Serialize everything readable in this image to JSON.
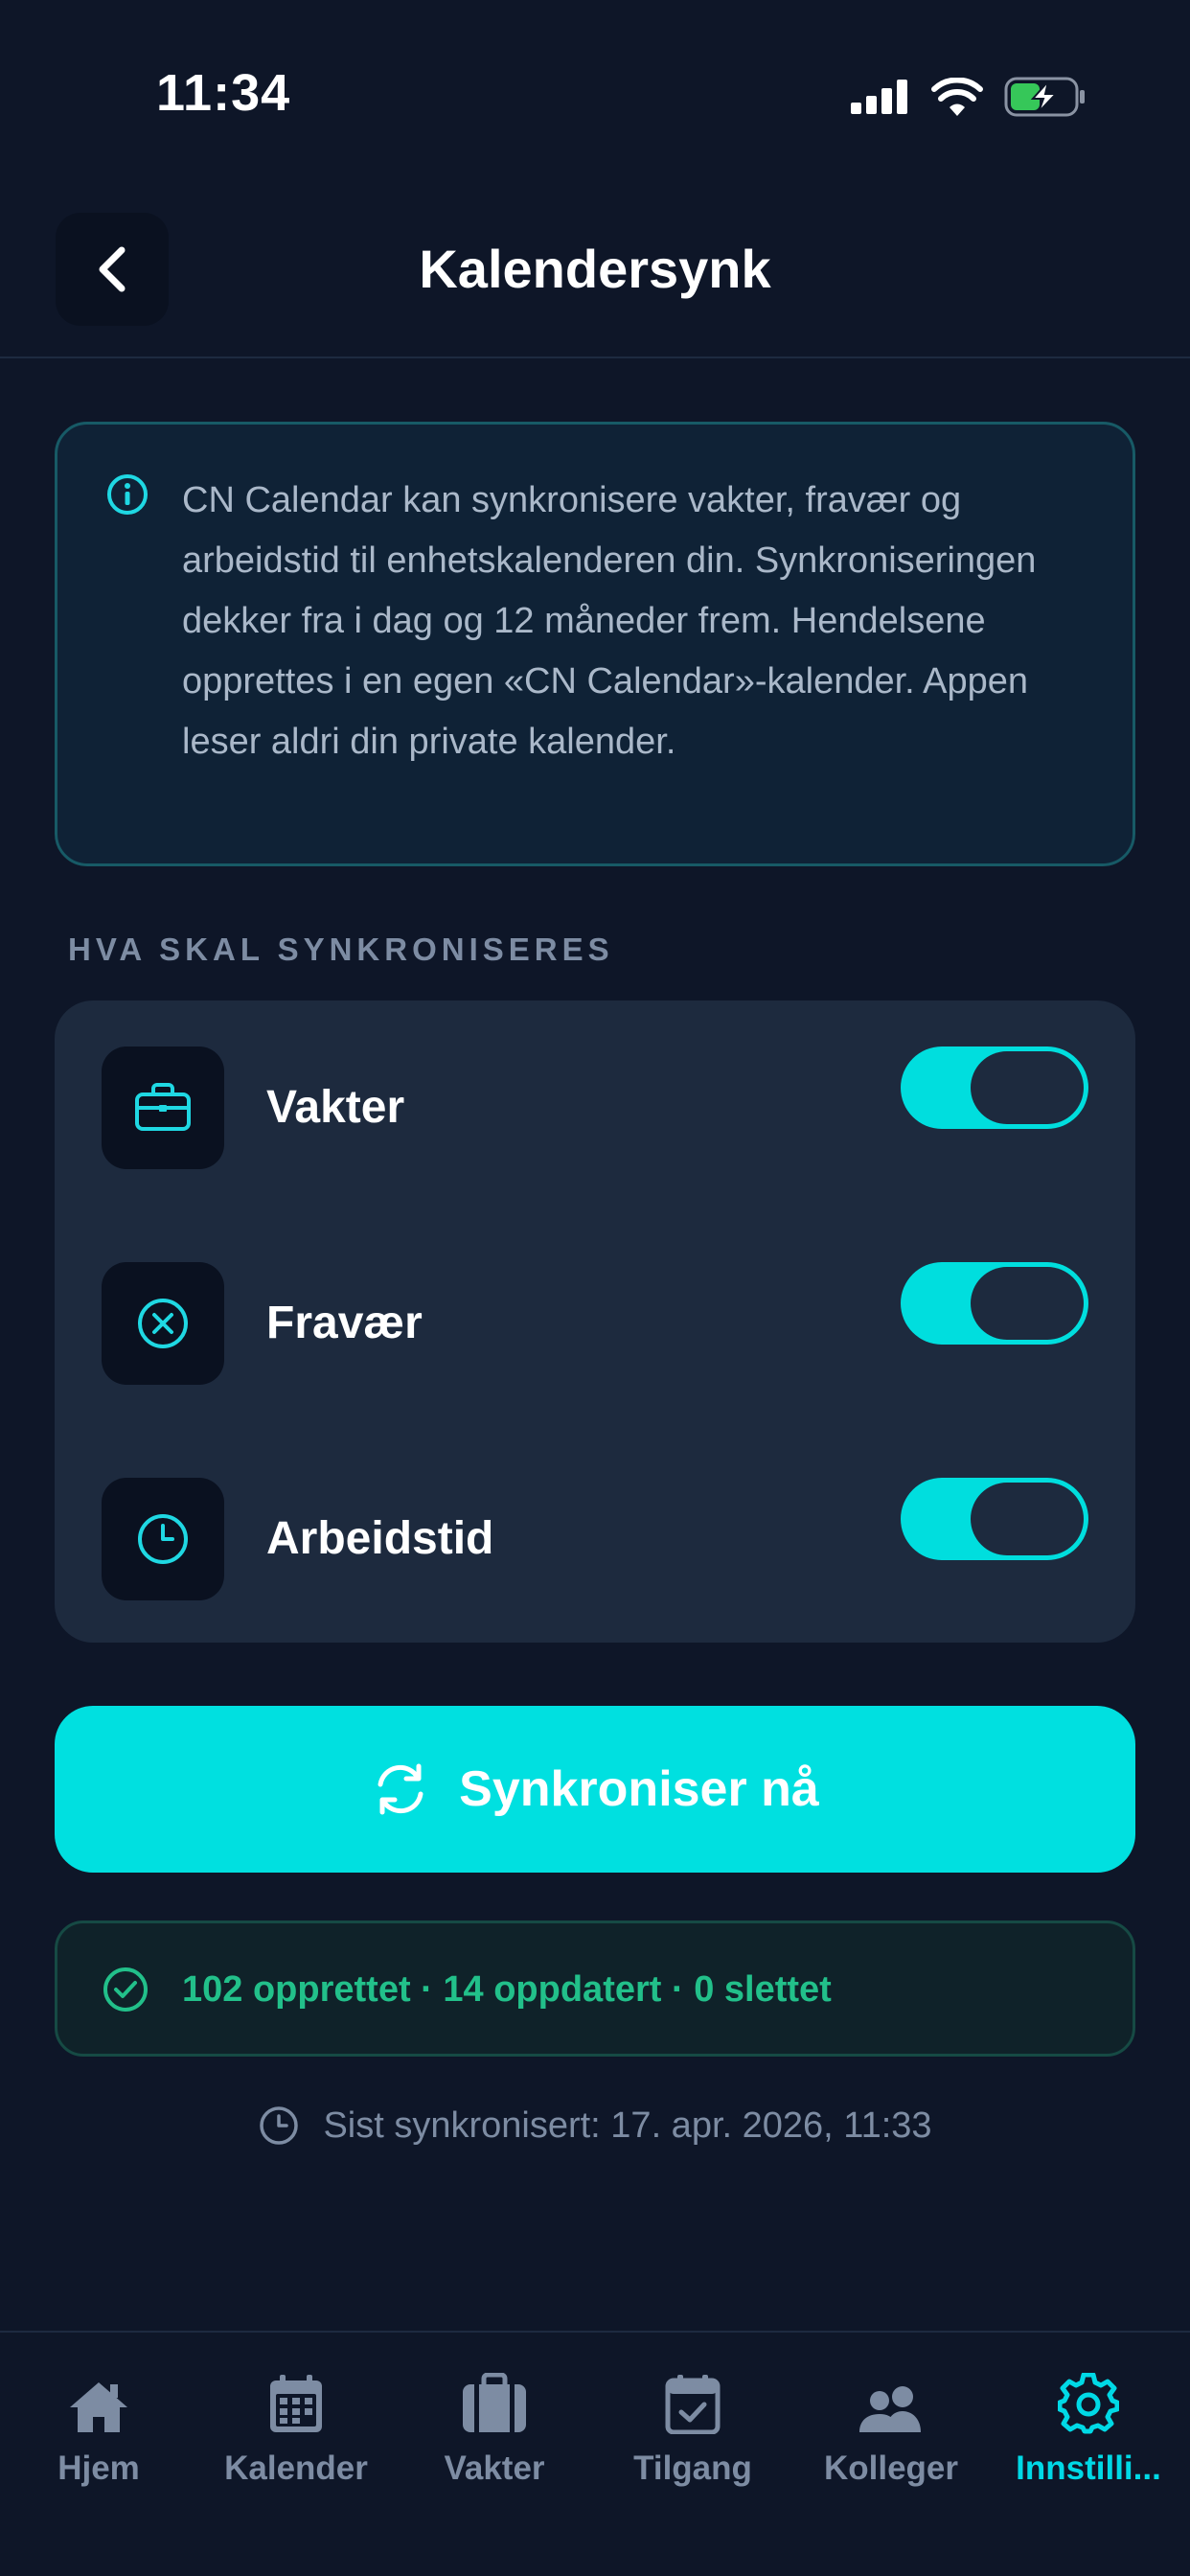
{
  "status_bar": {
    "time": "11:34",
    "battery_color": "#36c759"
  },
  "header": {
    "title": "Kalendersynk",
    "back_icon": "chevron-left-icon"
  },
  "info": {
    "icon": "info-icon",
    "text": "CN Calendar kan synkronisere vakter, fravær og arbeidstid til enhetskalenderen din. Synkroniseringen dekker fra i dag og 12 måneder frem. Hendelsene opprettes i en egen «CN Calendar»-kalender. Appen leser aldri din private kalender."
  },
  "section": {
    "label": "HVA SKAL SYNKRONISERES"
  },
  "options": [
    {
      "label": "Vakter",
      "icon": "briefcase-icon",
      "enabled": true
    },
    {
      "label": "Fravær",
      "icon": "x-circle-icon",
      "enabled": true
    },
    {
      "label": "Arbeidstid",
      "icon": "clock-icon",
      "enabled": true
    }
  ],
  "sync_button": {
    "label": "Synkroniser nå",
    "icon": "refresh-icon"
  },
  "result": {
    "icon": "check-circle-icon",
    "text": "102 opprettet · 14 oppdatert · 0 slettet"
  },
  "last_synced": {
    "icon": "clock-icon",
    "text": "Sist synkronisert: 17. apr. 2026, 11:33"
  },
  "tabs": [
    {
      "label": "Hjem",
      "icon": "home-icon",
      "active": false
    },
    {
      "label": "Kalender",
      "icon": "calendar-icon",
      "active": false
    },
    {
      "label": "Vakter",
      "icon": "suitcase-icon",
      "active": false
    },
    {
      "label": "Tilgang",
      "icon": "calendar-check-icon",
      "active": false
    },
    {
      "label": "Kolleger",
      "icon": "people-icon",
      "active": false
    },
    {
      "label": "Innstilli...",
      "icon": "gear-icon",
      "active": true
    }
  ],
  "colors": {
    "background": "#0e1628",
    "accent": "#00e0e0",
    "success": "#22c08a",
    "muted": "#7d8ca3"
  }
}
